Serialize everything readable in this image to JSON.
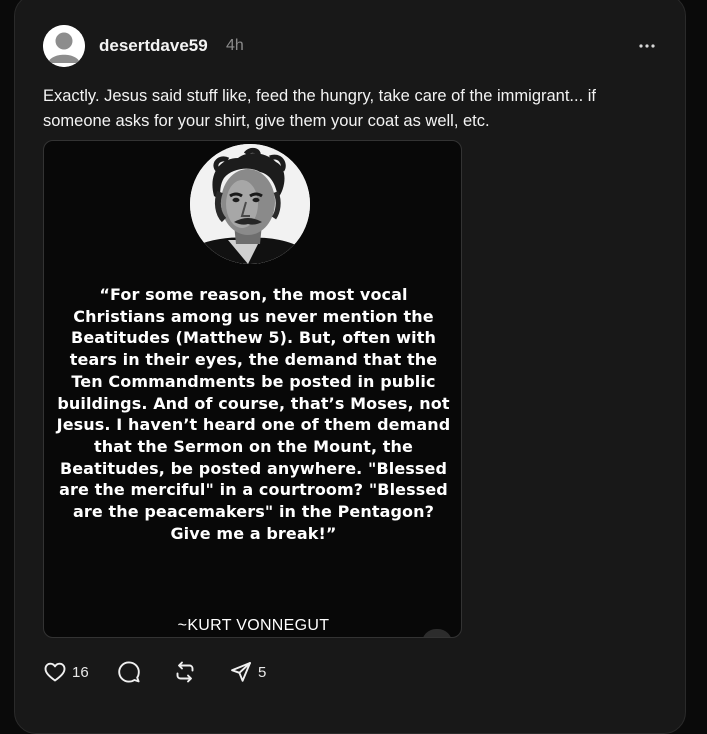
{
  "post": {
    "username": "desertdave59",
    "timestamp": "4h",
    "text": "Exactly. Jesus said stuff like, feed the hungry, take care of the immigrant... if someone asks for your shirt, give them your coat as well, etc."
  },
  "media": {
    "quote": "“For some reason, the most vocal Christians among us never mention the Beatitudes (Matthew 5). But, often with tears in their eyes, the demand that the Ten Commandments be posted in public buildings. And of course, that’s Moses, not Jesus. I haven’t heard one of them demand that the Sermon on the Mount, the Beatitudes, be posted anywhere. \"Blessed are the merciful\" in a courtroom? \"Blessed are the peacemakers\" in the Pentagon? Give me a break!”",
    "author": "~KURT VONNEGUT"
  },
  "actions": {
    "likes": "16",
    "reposts_label": "",
    "shares": "5"
  },
  "icons": {
    "avatar": "default-avatar-icon",
    "more": "more-options-icon",
    "like": "heart-icon",
    "comment": "comment-bubble-icon",
    "repost": "repost-icon",
    "share": "send-icon"
  },
  "colors": {
    "background": "#0a0a0a",
    "card": "#181818",
    "text": "#f3f3f3",
    "muted": "#8a8a8a"
  }
}
